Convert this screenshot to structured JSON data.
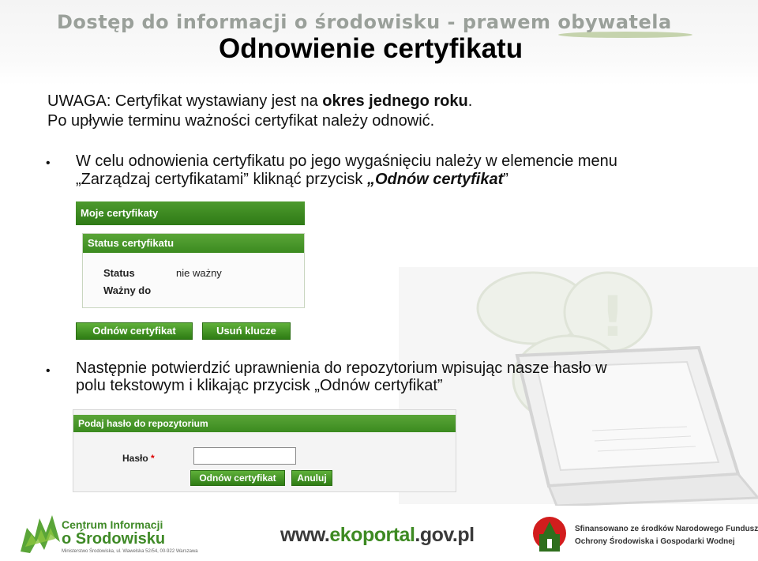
{
  "header": {
    "banner": "Dostęp do informacji o środowisku - prawem obywatela",
    "title": "Odnowienie certyfikatu"
  },
  "notice": {
    "line1_prefix": "UWAGA: Certyfikat wystawiany jest na ",
    "line1_bold": "okres jednego roku",
    "line1_suffix": ".",
    "line2": "Po upływie terminu ważności certyfikat należy odnowić."
  },
  "bullet1": {
    "line1": "W celu odnowienia certyfikatu po jego wygaśnięciu należy w elemencie menu",
    "line2_prefix": "„Zarządzaj certyfikatami” kliknąć przycisk ",
    "line2_bold": "„Odnów certyfikat",
    "line2_suffix": "”"
  },
  "screenshot1": {
    "header": "Moje certyfikaty",
    "panel_title": "Status certyfikatu",
    "status_label": "Status",
    "status_value": "nie ważny",
    "valid_label": "Ważny do",
    "renew_button": "Odnów certyfikat",
    "delete_button": "Usuń klucze"
  },
  "bullet2": {
    "line1": "Następnie potwierdzić uprawnienia do repozytorium wpisując nasze hasło w",
    "line2": "polu tekstowym i klikając przycisk „Odnów certyfikat”"
  },
  "screenshot2": {
    "header": "Podaj hasło do repozytorium",
    "password_label": "Hasło",
    "required_mark": "*",
    "password_value": "",
    "renew_button": "Odnów certyfikat",
    "cancel_button": "Anuluj"
  },
  "footer": {
    "cio_line1": "Centrum Informacji",
    "cio_line2": "o Środowisku",
    "cio_address": "Ministerstwo Środowiska, ul. Wawelska 52/54, 00-922 Warszawa",
    "ekoportal_prefix": "www.",
    "ekoportal_green": "ekoportal",
    "ekoportal_suffix": ".gov.pl",
    "nf_line1": "Sfinansowano ze środków Narodowego Funduszu",
    "nf_line2": "Ochrony Środowiska i Gospodarki Wodnej"
  },
  "colors": {
    "accent_green": "#3b8a1f",
    "nf_red": "#d21d1d"
  }
}
